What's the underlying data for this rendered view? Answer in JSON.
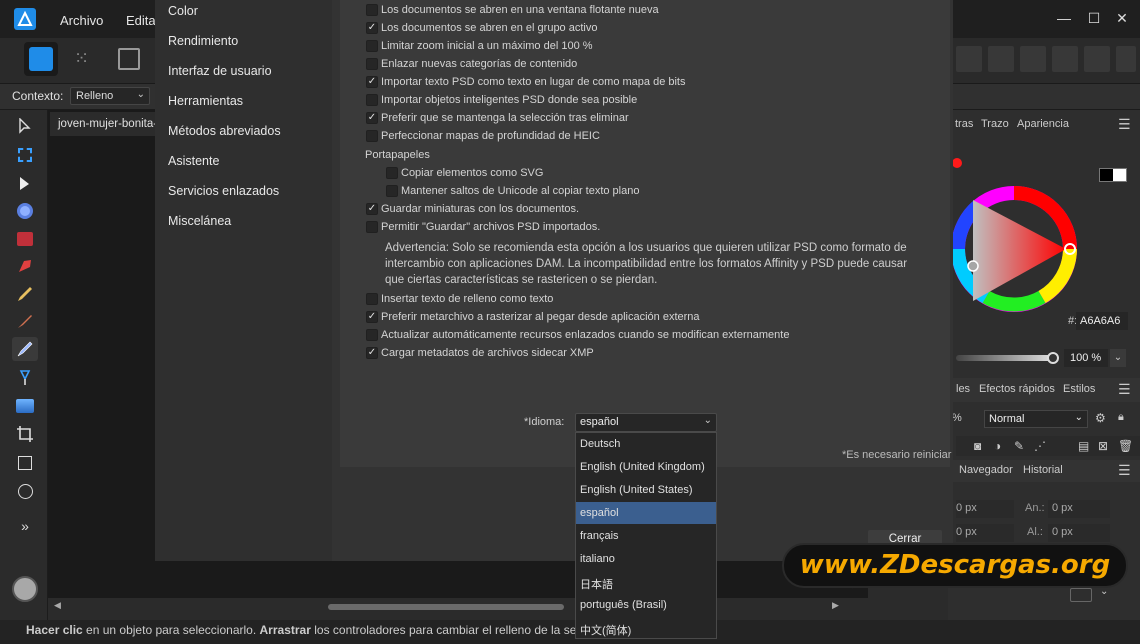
{
  "menu": {
    "file": "Archivo",
    "edit": "Editar"
  },
  "context": {
    "label": "Contexto:",
    "value": "Relleno"
  },
  "document_tab": "joven-mujer-bonita-",
  "nav": [
    "Color",
    "Rendimiento",
    "Interfaz de usuario",
    "Herramientas",
    "Métodos abreviados",
    "Asistente",
    "Servicios enlazados",
    "Miscelánea"
  ],
  "options": [
    {
      "label": "Los documentos se abren en una ventana flotante nueva",
      "checked": false,
      "indent": false
    },
    {
      "label": "Los documentos se abren en el grupo activo",
      "checked": true,
      "indent": false
    },
    {
      "label": "Limitar zoom inicial a un máximo del 100 %",
      "checked": false,
      "indent": false
    },
    {
      "label": "Enlazar nuevas categorías de contenido",
      "checked": false,
      "indent": false
    },
    {
      "label": "Importar texto PSD como texto en lugar de como mapa de bits",
      "checked": true,
      "indent": false
    },
    {
      "label": "Importar objetos inteligentes PSD donde sea posible",
      "checked": false,
      "indent": false
    },
    {
      "label": "Preferir que se mantenga la selección tras eliminar",
      "checked": true,
      "indent": false
    },
    {
      "label": "Perfeccionar mapas de profundidad de HEIC",
      "checked": false,
      "indent": false
    }
  ],
  "clipboard": {
    "heading": "Portapapeles",
    "options": [
      {
        "label": "Copiar elementos como SVG",
        "checked": false
      },
      {
        "label": "Mantener saltos de Unicode al copiar texto plano",
        "checked": false
      }
    ]
  },
  "options2": [
    {
      "label": "Guardar miniaturas con los documentos.",
      "checked": true
    },
    {
      "label": "Permitir \"Guardar\" archivos PSD importados.",
      "checked": false
    }
  ],
  "warning": [
    "Advertencia: Solo se recomienda esta opción a los usuarios que quieren utilizar PSD como formato de",
    "intercambio con aplicaciones DAM. La incompatibilidad entre los formatos Affinity y PSD puede causar",
    "que ciertas características se rastericen o se pierdan."
  ],
  "options3": [
    {
      "label": "Insertar texto de relleno como texto",
      "checked": false
    },
    {
      "label": "Preferir metarchivo a rasterizar al pegar desde aplicación externa",
      "checked": true
    },
    {
      "label": "Actualizar automáticamente recursos enlazados cuando se modifican externamente",
      "checked": false
    },
    {
      "label": "Cargar metadatos de archivos sidecar XMP",
      "checked": true
    }
  ],
  "language": {
    "label": "*Idioma:",
    "value": "español",
    "options": [
      "Deutsch",
      "English (United Kingdom)",
      "English (United States)",
      "español",
      "français",
      "italiano",
      "日本語",
      "português (Brasil)",
      "中文(简体)"
    ],
    "selected_index": 3
  },
  "restart_note": "*Es necesario reiniciar",
  "close_button": "Cerrar",
  "right_panel": {
    "tabs_top": [
      "tras",
      "Trazo",
      "Apariencia"
    ],
    "hex_prefix": "#:",
    "hex": "A6A6A6",
    "opacity": "100 %",
    "tabs_mid": [
      "les",
      "Efectos rápidos",
      "Estilos"
    ],
    "blend_prefix": "%",
    "blend": "Normal",
    "tabs_bottom": [
      "Navegador",
      "Historial"
    ],
    "fields": [
      {
        "prefix": "",
        "value": "0 px",
        "label": "An.:",
        "value2": "0 px"
      },
      {
        "prefix": "",
        "value": "0 px",
        "label": "Al.:",
        "value2": "0 px"
      }
    ]
  },
  "status": {
    "b1": "Hacer clic",
    "t1": " en un objeto para seleccionarlo. ",
    "b2": "Arrastrar",
    "t2": " los controladores para cambiar el relleno de la sele"
  },
  "watermark": "www.ZDescargas.org",
  "colors": {
    "accent": "#3b5f8f",
    "brand": "#1f8ce8",
    "watermark": "#f6a900"
  }
}
